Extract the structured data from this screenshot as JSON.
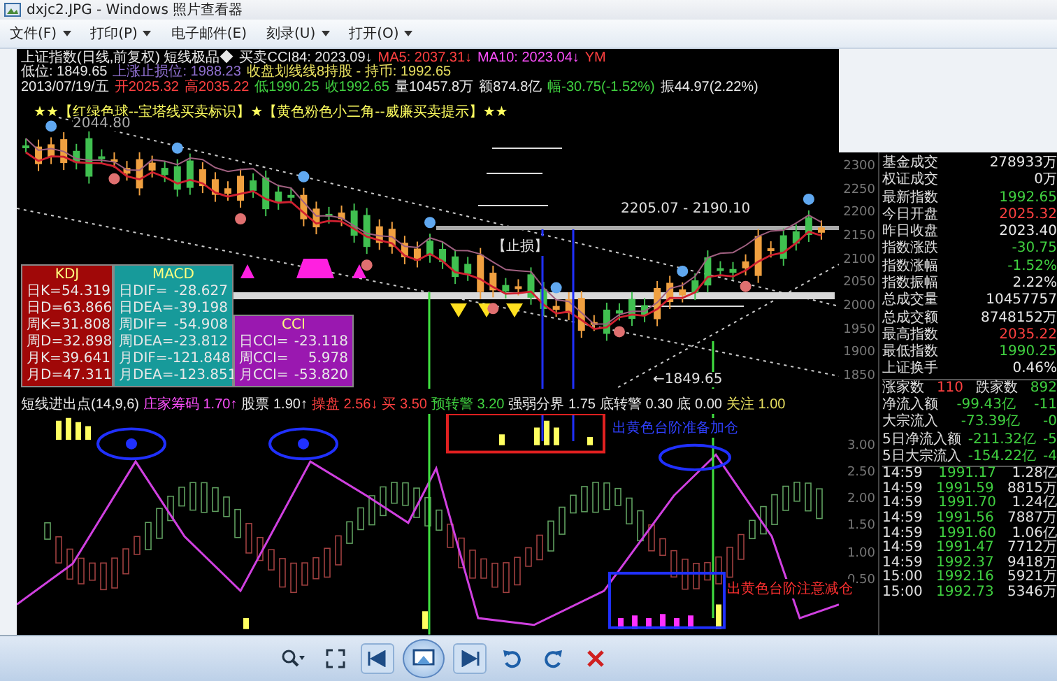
{
  "window": {
    "title": "dxjc2.JPG - Windows 照片查看器"
  },
  "menu": [
    {
      "label": "文件(F)",
      "dropdown": true
    },
    {
      "label": "打印(P)",
      "dropdown": true
    },
    {
      "label": "电子邮件(E)",
      "dropdown": false
    },
    {
      "label": "刻录(U)",
      "dropdown": true
    },
    {
      "label": "打开(O)",
      "dropdown": true
    }
  ],
  "chart_header": [
    [
      {
        "text": "上证指数(日线,前复权) 短线极品◆",
        "kind": "plain"
      },
      {
        "text": "买卖CCI84: 2023.09↓",
        "kind": "plain"
      },
      {
        "text": "MA5: 2037.31↓",
        "kind": "up"
      },
      {
        "text": "MA10: 2023.04↓",
        "kind": "ma"
      },
      {
        "text": "YM",
        "kind": "up"
      }
    ],
    [
      {
        "text": "低位: 1849.65",
        "kind": "plain"
      },
      {
        "text": "上涨止损位: 1988.23",
        "kind": "stop"
      },
      {
        "text": "收盘划线线8持股 - 持币: 1992.65",
        "kind": "hold"
      }
    ],
    [
      {
        "text": "2013/07/19/五",
        "kind": "plain"
      },
      {
        "text": "开2025.32",
        "kind": "up"
      },
      {
        "text": "高2035.22",
        "kind": "up"
      },
      {
        "text": "低1990.25",
        "kind": "down"
      },
      {
        "text": "收1992.65",
        "kind": "down"
      },
      {
        "text": "量10457.8万",
        "kind": "plain"
      },
      {
        "text": "额874.8亿",
        "kind": "plain"
      },
      {
        "text": "幅-30.75(-1.52%)",
        "kind": "down"
      },
      {
        "text": "振44.97(2.22%)",
        "kind": "plain"
      }
    ]
  ],
  "legend": "★★【红绿色球--宝塔线买卖标识】★【黄色粉色小三角--威廉买卖提示】★★",
  "chart_notes": {
    "high": "2044.80",
    "range": "2205.07 - 2190.10",
    "stop_loss": "【止损】",
    "low": "←1849.65"
  },
  "indicator_panels": [
    {
      "title": "KDJ",
      "kind": "kdj",
      "rows": [
        {
          "label": "日K=",
          "value": "54.319"
        },
        {
          "label": "日D=",
          "value": "63.866"
        },
        {
          "label": "周K=",
          "value": "31.808"
        },
        {
          "label": "周D=",
          "value": "32.898"
        },
        {
          "label": "月K=",
          "value": "39.641"
        },
        {
          "label": "月D=",
          "value": "47.311"
        }
      ]
    },
    {
      "title": "MACD",
      "kind": "macd",
      "rows": [
        {
          "label": "日DIF=",
          "value": "-28.627"
        },
        {
          "label": "日DEA=",
          "value": "-39.198"
        },
        {
          "label": "周DIF=",
          "value": "-54.908"
        },
        {
          "label": "周DEA=",
          "value": "-23.812"
        },
        {
          "label": "月DIF=",
          "value": "-121.848"
        },
        {
          "label": "月DEA=",
          "value": "-123.851"
        }
      ]
    },
    {
      "title": "CCI",
      "kind": "cci",
      "rows": [
        {
          "label": "日CCI=",
          "value": "-23.118"
        },
        {
          "label": "周CCI=",
          "value": "5.978"
        },
        {
          "label": "月CCI=",
          "value": "-53.820"
        }
      ]
    }
  ],
  "oscillator_header": [
    {
      "text": "短线进出点(14,9,6)",
      "kind": "plain"
    },
    {
      "text": "庄家筹码 1.70↑",
      "kind": "ma"
    },
    {
      "text": "股票 1.90↑",
      "kind": "plain"
    },
    {
      "text": "操盘 2.56↓",
      "kind": "up"
    },
    {
      "text": "买 3.50",
      "kind": "up"
    },
    {
      "text": "预转警 3.20",
      "kind": "down"
    },
    {
      "text": "强弱分界 1.75",
      "kind": "plain"
    },
    {
      "text": "底转警 0.30",
      "kind": "plain"
    },
    {
      "text": "底 0.00",
      "kind": "plain"
    },
    {
      "text": "关注 1.00",
      "kind": "hold"
    }
  ],
  "oscillator_notes": {
    "upper": "出黄色台阶准备加仓",
    "lower": "出黄色台阶注意减仓"
  },
  "price_axis": [
    "2300",
    "2250",
    "2200",
    "2150",
    "2100",
    "2050",
    "2000",
    "1950",
    "1900",
    "1850"
  ],
  "oscillator_axis": [
    "3.00",
    "2.50",
    "2.00",
    "1.50",
    "1.00",
    "0.50"
  ],
  "quote": [
    {
      "label": "基金成交",
      "value": "278933万",
      "kind": "plain"
    },
    {
      "label": "权证成交",
      "value": "0万",
      "kind": "plain"
    },
    {
      "label": "最新指数",
      "value": "1992.65",
      "kind": "down"
    },
    {
      "label": "今日开盘",
      "value": "2025.32",
      "kind": "up"
    },
    {
      "label": "昨日收盘",
      "value": "2023.40",
      "kind": "plain"
    },
    {
      "label": "指数涨跌",
      "value": "-30.75",
      "kind": "down"
    },
    {
      "label": "指数涨幅",
      "value": "-1.52%",
      "kind": "down"
    },
    {
      "label": "指数振幅",
      "value": "2.22%",
      "kind": "plain"
    },
    {
      "label": "总成交量",
      "value": "10457757",
      "kind": "plain"
    },
    {
      "label": "总成交额",
      "value": "8748152万",
      "kind": "plain"
    },
    {
      "label": "最高指数",
      "value": "2035.22",
      "kind": "up"
    },
    {
      "label": "最低指数",
      "value": "1990.25",
      "kind": "down"
    },
    {
      "label": "上证换手",
      "value": "0.46%",
      "kind": "plain"
    }
  ],
  "breadth": {
    "up_label": "涨家数",
    "up_count": "110",
    "down_label": "跌家数",
    "down_count": "892"
  },
  "flows": [
    {
      "label": "净流入额",
      "value": "-99.43亿",
      "pct": "-11"
    },
    {
      "label": "大宗流入",
      "value": "-73.39亿",
      "pct": "-0"
    },
    {
      "label": "5日净流入额",
      "value": "-211.32亿",
      "pct": "-5"
    },
    {
      "label": "5日大宗流入",
      "value": "-154.22亿",
      "pct": "-4"
    }
  ],
  "ticks": [
    {
      "time": "14:59",
      "price": "1991.17",
      "volume": "1.28亿"
    },
    {
      "time": "14:59",
      "price": "1991.59",
      "volume": "8815万"
    },
    {
      "time": "14:59",
      "price": "1991.70",
      "volume": "1.24亿"
    },
    {
      "time": "14:59",
      "price": "1991.56",
      "volume": "7887万"
    },
    {
      "time": "14:59",
      "price": "1991.60",
      "volume": "1.06亿"
    },
    {
      "time": "14:59",
      "price": "1991.47",
      "volume": "7712万"
    },
    {
      "time": "14:59",
      "price": "1992.37",
      "volume": "9418万"
    },
    {
      "time": "15:00",
      "price": "1992.16",
      "volume": "5921万"
    },
    {
      "time": "15:00",
      "price": "1992.73",
      "volume": "5346万"
    }
  ]
}
